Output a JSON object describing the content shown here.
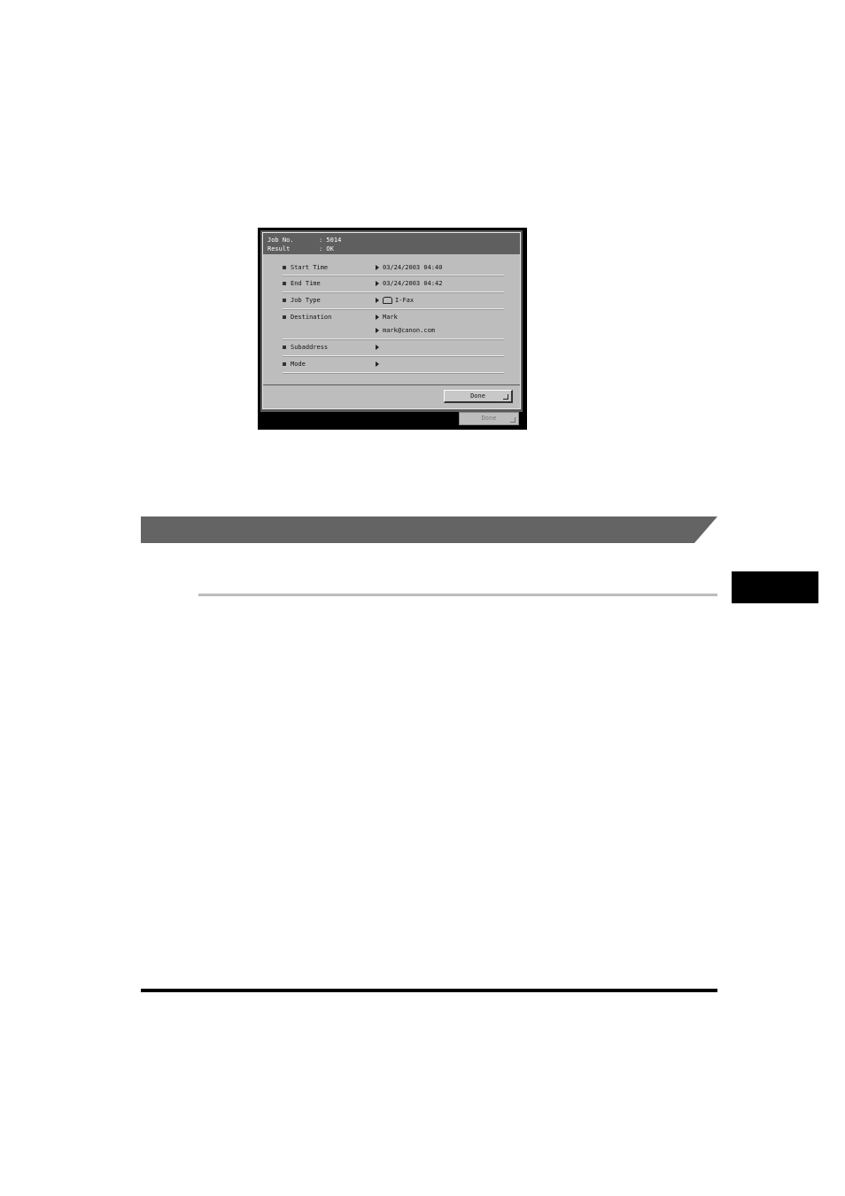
{
  "job_detail": {
    "header": {
      "job_no_label": "Job No.",
      "job_no_value": ": 5014",
      "result_label": "Result",
      "result_value": ": OK"
    },
    "rows": {
      "start_time": {
        "label": "Start Time",
        "value": "03/24/2003 04:40"
      },
      "end_time": {
        "label": "End Time",
        "value": "03/24/2003 04:42"
      },
      "job_type": {
        "label": "Job Type",
        "value": "I-Fax",
        "icon": "ifax-icon"
      },
      "destination": {
        "label": "Destination",
        "value_1": "Mark",
        "value_2": "mark@canon.com"
      },
      "subaddress": {
        "label": "Subaddress",
        "value": ""
      },
      "mode": {
        "label": "Mode",
        "value": ""
      }
    },
    "done_label": "Done",
    "background_done_label": "Done"
  },
  "colors": {
    "header_bg": "#5f5f5f",
    "panel_bg": "#bdbdbd",
    "section_bar": "#646464",
    "chapter_tab": "#000000"
  }
}
